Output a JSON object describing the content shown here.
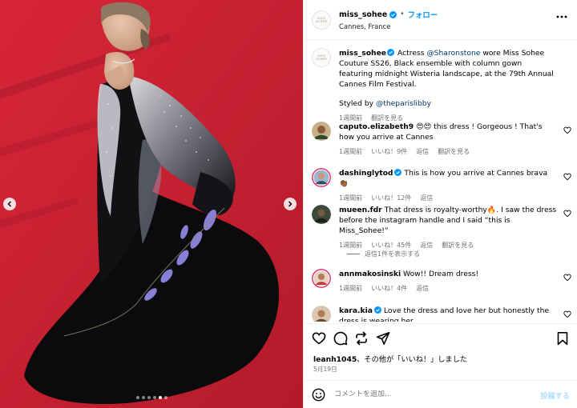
{
  "media": {
    "slide_count": 6,
    "active_slide": 5,
    "prev_icon": "chevron-left-icon",
    "next_icon": "chevron-right-icon",
    "colors": {
      "carpet": "#c21f2d",
      "gown": "#0b0b0d",
      "wisteria": "#8a7fd6"
    }
  },
  "header": {
    "avatar_text": "MISS SOHEE",
    "username": "miss_sohee",
    "verified_icon": "verified-badge-icon",
    "separator": "•",
    "follow_label": "フォロー",
    "location": "Cannes, France",
    "more_icon": "more-options-icon"
  },
  "caption": {
    "username": "miss_sohee",
    "text_before": " Actress ",
    "mention": "@Sharonstone",
    "text_after": " wore Miss Sohee Couture SS26, Black ensemble with column gown featuring midnight Wisteria landscape, at the 79th Annual Cannes Film Festival.",
    "styled_prefix": "Styled by ",
    "styled_mention": "@theparislibby",
    "time": "1週間前",
    "translate": "翻訳を見る"
  },
  "comments": [
    {
      "username": "caputo.elizabeth9",
      "verified": false,
      "text": " 😍😍 this dress ! Gorgeous ! That's how you arrive at Cannes",
      "time": "1週間前",
      "likes": "いいね！9件",
      "reply": "返信",
      "translate": "翻訳を見る"
    },
    {
      "username": "dashinglytod",
      "verified": true,
      "text": " This is how you arrive at Cannes brava 👏🏾",
      "time": "1週間前",
      "likes": "いいね！12件",
      "reply": "返信",
      "translate": ""
    },
    {
      "username": "mueen.fdr",
      "verified": false,
      "text": " That dress is royalty-worthy🔥. I saw the dress before the instagram handle and I said “this is Miss_Sohee!”",
      "time": "1週間前",
      "likes": "いいね！45件",
      "reply": "返信",
      "translate": "翻訳を見る"
    },
    {
      "username": "annmakosinski",
      "verified": false,
      "text": " Wow!! Dream dress!",
      "time": "1週間前",
      "likes": "いいね！4件",
      "reply": "返信",
      "translate": ""
    },
    {
      "username": "kara.kia",
      "verified": true,
      "text": " Love the dress and love her but honestly the dress is wearing her",
      "time": "",
      "likes": "",
      "reply": "",
      "translate": ""
    }
  ],
  "view_replies": "返信1件を表示する",
  "actions": {
    "like_icon": "heart-icon",
    "comment_icon": "comment-icon",
    "share_icon": "share-icon",
    "repost_icon": "repost-icon",
    "save_icon": "bookmark-icon"
  },
  "likes_line": {
    "username": "leanh1045",
    "text": "、その他が「いいね！」しました"
  },
  "date": "5月19日",
  "composer": {
    "emoji_icon": "emoji-icon",
    "placeholder": "コメントを追加...",
    "post_label": "投稿する"
  }
}
